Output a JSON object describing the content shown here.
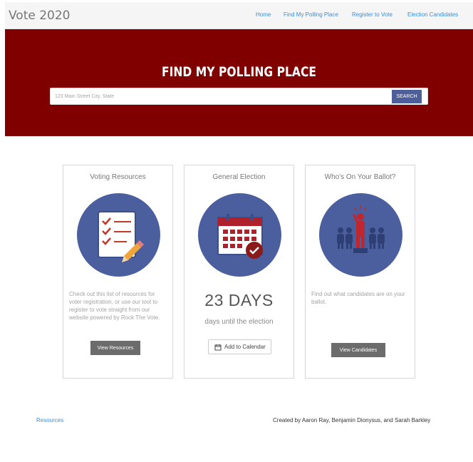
{
  "navbar": {
    "brand": "Vote 2020",
    "links": [
      "Home",
      "Find My Polling Place",
      "Register to Vote",
      "Election Candidates"
    ]
  },
  "hero": {
    "title": "FIND MY POLLING PLACE",
    "search_placeholder": "123 Main Street City, State",
    "search_button": "SEARCH"
  },
  "cards": {
    "resources": {
      "title": "Voting Resources",
      "text": "Check out this list of resources for voter registration, or use our tool to register to vote straight from our website powered by Rock The Vote.",
      "button": "View Resources"
    },
    "election": {
      "title": "General Election",
      "days": "23 DAYS",
      "subtext": "days until the election",
      "button": "Add to Calendar"
    },
    "ballot": {
      "title": "Who's On Your Ballot?",
      "text": "Find out what candidates are on your ballot.",
      "button": "View Candidates"
    }
  },
  "footer": {
    "link": "Resources",
    "credit": "Created by Aaron Ray, Benjamin Dionysus, and Sarah Barkley"
  },
  "colors": {
    "hero_bg": "#800000",
    "circle_bg": "#4b5f9e",
    "link": "#3a8fd6",
    "search_button": "#4e5e9b"
  },
  "icons": [
    "checklist-icon",
    "pencil-icon",
    "calendar-icon",
    "checkmark-badge-icon",
    "candidate-people-icon",
    "small-calendar-icon"
  ]
}
